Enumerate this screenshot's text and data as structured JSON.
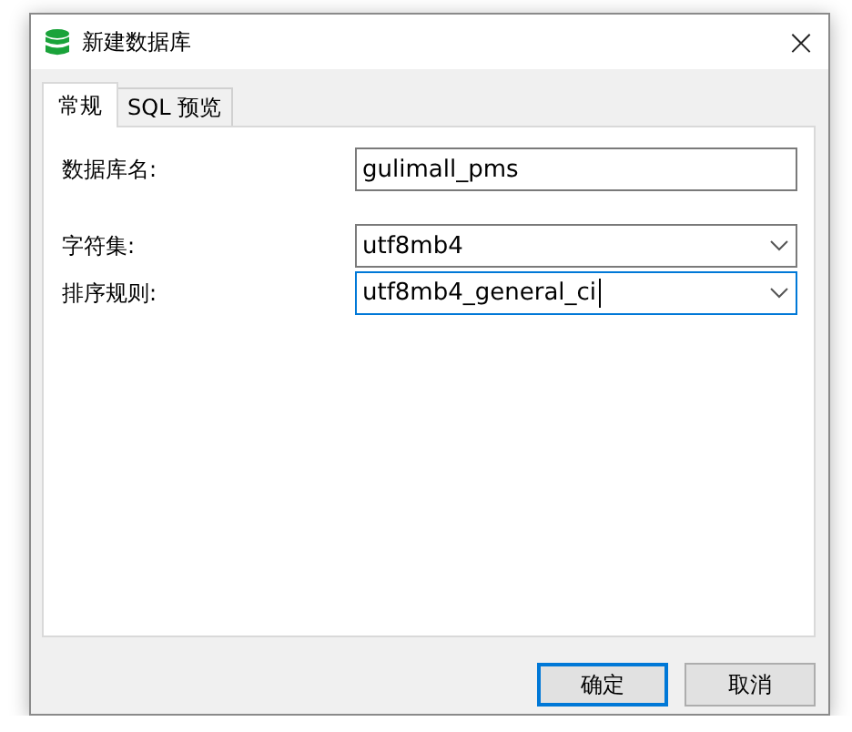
{
  "window": {
    "title": "新建数据库",
    "close": "×"
  },
  "tabs": [
    {
      "label": "常规",
      "selected": true
    },
    {
      "label": "SQL 预览",
      "selected": false
    }
  ],
  "fields": [
    {
      "kind": "text",
      "label": "数据库名:",
      "value": "gulimall_pms",
      "focused": false
    },
    {
      "kind": "select",
      "label": "字符集:",
      "value": "utf8mb4",
      "focused": false
    },
    {
      "kind": "select",
      "label": "排序规则:",
      "value": "utf8mb4_general_ci",
      "focused": true
    }
  ],
  "buttons": [
    {
      "label": "确定",
      "default": true
    },
    {
      "label": "取消",
      "default": false
    }
  ]
}
